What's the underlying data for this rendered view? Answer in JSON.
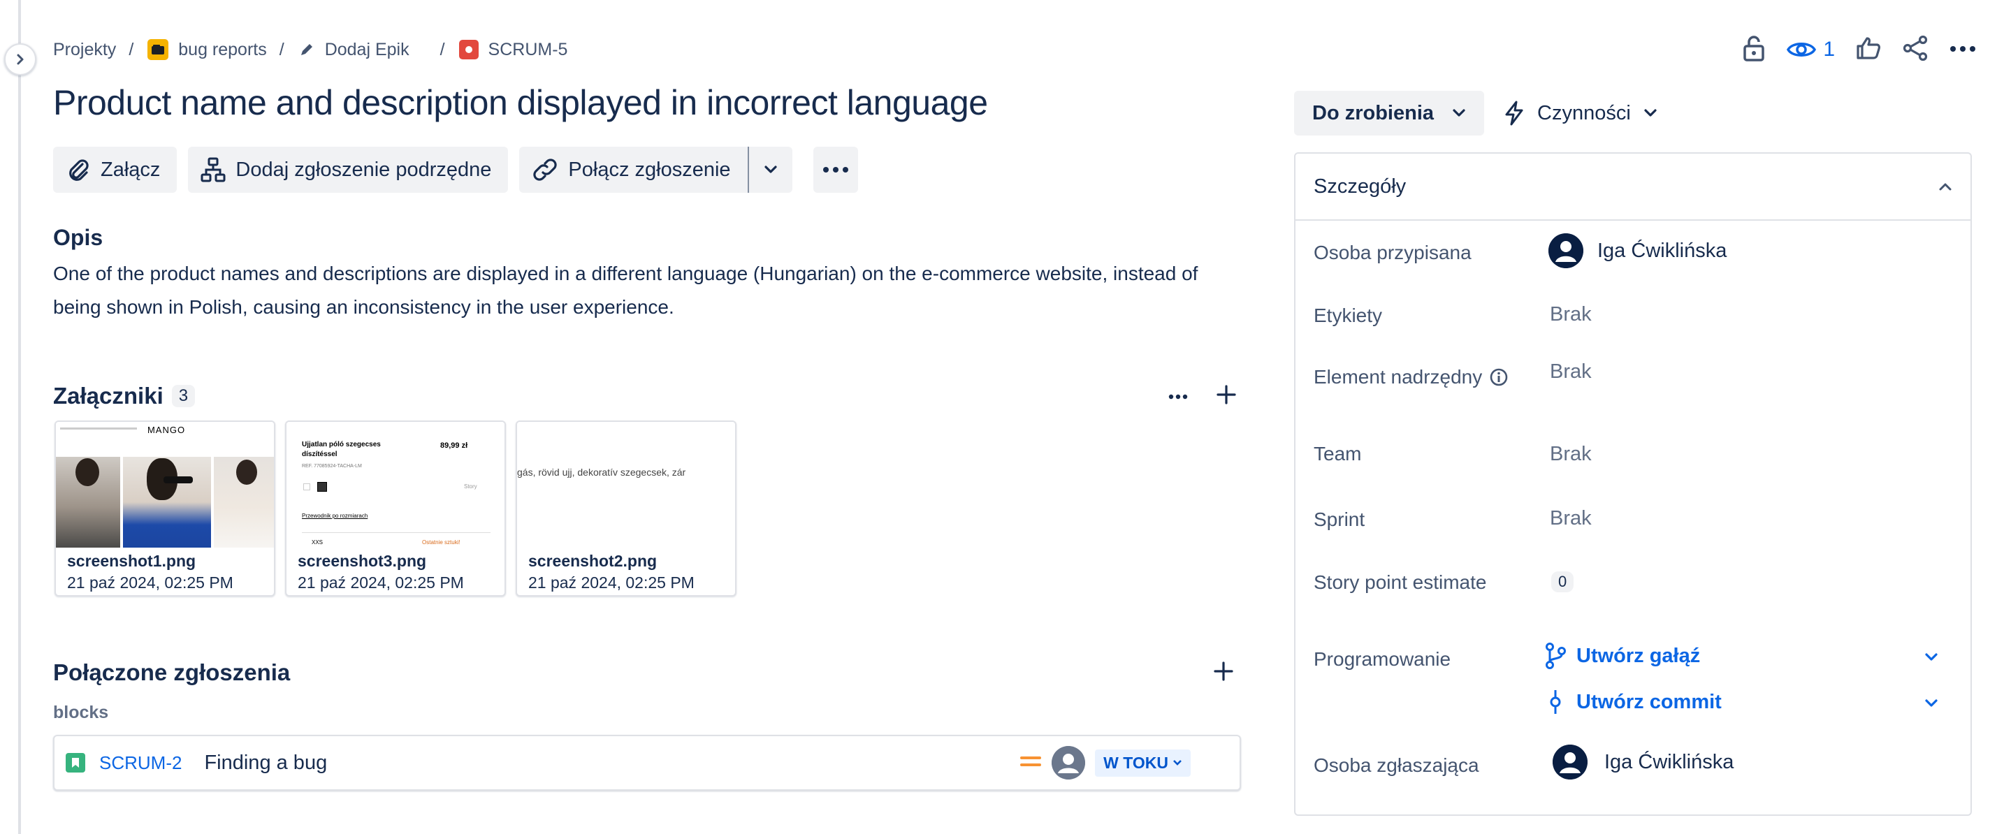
{
  "breadcrumb": {
    "projects": "Projekty",
    "project": "bug reports",
    "epic": "Dodaj Epik",
    "issue_key": "SCRUM-5",
    "separator": "/"
  },
  "top_actions": {
    "watchers_count": "1"
  },
  "issue": {
    "title": "Product name and description displayed in incorrect language",
    "description_heading": "Opis",
    "description": "One of the product names and descriptions are displayed in a different language (Hungarian) on the e-commerce website, instead of being shown in Polish, causing an inconsistency in the user experience."
  },
  "toolbar": {
    "attach": "Załącz",
    "add_child": "Dodaj zgłoszenie podrzędne",
    "link_issue": "Połącz zgłoszenie"
  },
  "attachments": {
    "heading": "Załączniki",
    "count": "3",
    "items": [
      {
        "name": "screenshot1.png",
        "date": "21 paź 2024, 02:25 PM",
        "preview_brand": "MANGO"
      },
      {
        "name": "screenshot3.png",
        "date": "21 paź 2024, 02:25 PM",
        "preview_title": "Ujjatlan póló szegecses díszítéssel",
        "preview_price": "89,99 zł",
        "preview_ref": "REF. 77085924-TACHA-LM",
        "preview_guide": "Przewodnik po rozmiarach",
        "preview_size": "XXS",
        "preview_stock": "Ostatnie sztuki!",
        "preview_story": "Story"
      },
      {
        "name": "screenshot2.png",
        "date": "21 paź 2024, 02:25 PM",
        "preview_text": "gás, rövid ujj, dekoratív szegecsek, zár"
      }
    ]
  },
  "linked": {
    "heading": "Połączone zgłoszenia",
    "relation": "blocks",
    "items": [
      {
        "key": "SCRUM-2",
        "summary": "Finding a bug",
        "status": "W TOKU"
      }
    ]
  },
  "status": {
    "label": "Do zrobienia"
  },
  "actions": {
    "label": "Czynności"
  },
  "details": {
    "heading": "Szczegóły",
    "assignee_label": "Osoba przypisana",
    "assignee": "Iga Ćwiklińska",
    "labels_label": "Etykiety",
    "labels": "Brak",
    "parent_label": "Element nadrzędny",
    "parent": "Brak",
    "team_label": "Team",
    "team": "Brak",
    "sprint_label": "Sprint",
    "sprint": "Brak",
    "story_points_label": "Story point estimate",
    "story_points": "0",
    "dev_label": "Programowanie",
    "create_branch": "Utwórz gałąź",
    "create_commit": "Utwórz commit",
    "reporter_label": "Osoba zgłaszająca",
    "reporter": "Iga Ćwiklińska"
  },
  "colors": {
    "link_blue": "#0c66e4",
    "story_green": "#36b37e",
    "priority_orange": "#f79232",
    "bug_red": "#e2483d",
    "project_yellow": "#f5b301"
  }
}
